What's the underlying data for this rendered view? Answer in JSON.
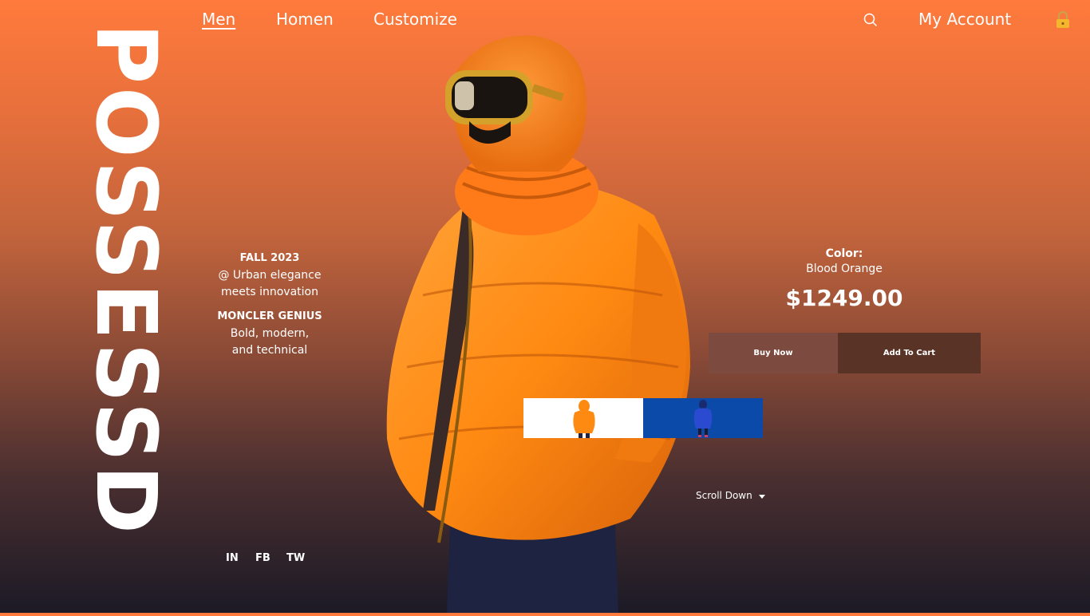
{
  "nav": {
    "links": [
      {
        "label": "Men",
        "active": true
      },
      {
        "label": "Homen",
        "active": false
      },
      {
        "label": "Customize",
        "active": false
      }
    ],
    "account_label": "My Account",
    "search_icon": "search-icon",
    "lock_icon": "lock-icon"
  },
  "brand": {
    "name": "POSSESSD"
  },
  "collection": {
    "season": "FALL 2023",
    "tagline_1": "@ Urban elegance",
    "tagline_2": "meets innovation",
    "designer": "MONCLER GENIUS",
    "desc_1": "Bold, modern,",
    "desc_2": "and technical"
  },
  "social": [
    "IN",
    "FB",
    "TW"
  ],
  "product": {
    "color_label": "Color:",
    "color_value": "Blood Orange",
    "price": "$1249.00",
    "buy_label": "Buy Now",
    "cart_label": "Add To Cart"
  },
  "thumbnails": [
    {
      "color": "orange",
      "background": "#ffffff"
    },
    {
      "color": "blue",
      "background": "#0b4aa8"
    }
  ],
  "scroll": {
    "label": "Scroll Down",
    "icon": "caret-down-icon"
  },
  "colors": {
    "gradient_top": "#ff7a3c",
    "gradient_bottom": "#1c1a26",
    "buy_button": "#7c4a3f",
    "cart_button": "#5a3327",
    "jacket": "#ff8a12"
  }
}
